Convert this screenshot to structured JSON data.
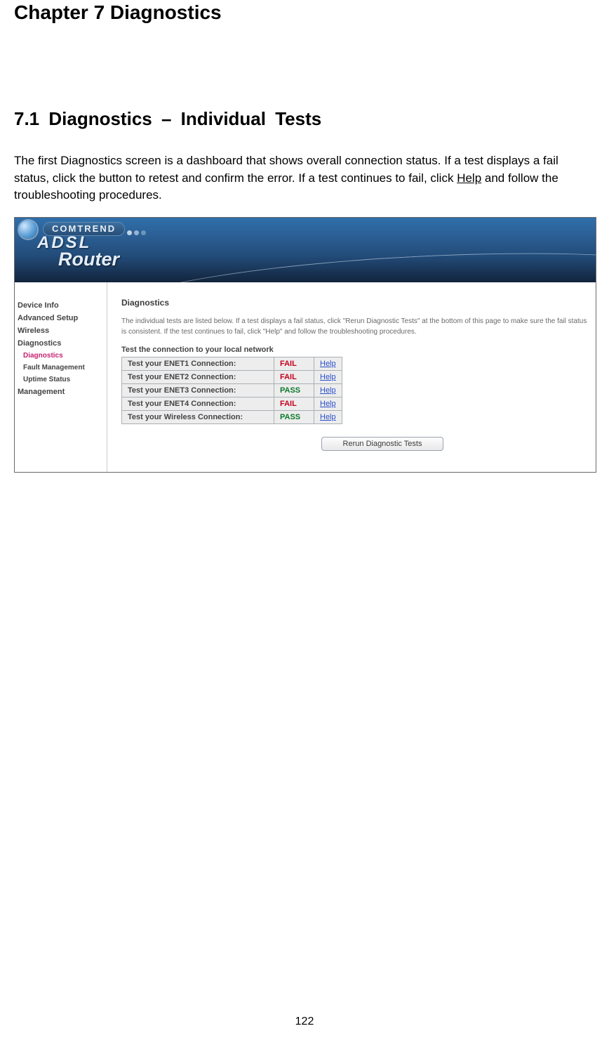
{
  "doc": {
    "chapter_title": "Chapter 7 Diagnostics",
    "section_title": "7.1 Diagnostics – Individual Tests",
    "body_text": "The first Diagnostics screen is a dashboard that shows overall connection status. If a test displays a fail status, click the button to retest and confirm the error. If a test continues to fail, click ",
    "body_help_word": "Help",
    "body_text_tail": " and follow the troubleshooting procedures.",
    "page_number": "122"
  },
  "router": {
    "brand": "COMTREND",
    "product_line1": "ADSL",
    "product_line2": "Router",
    "nav": {
      "items": [
        {
          "label": "Device Info",
          "active": false,
          "sub": false
        },
        {
          "label": "Advanced Setup",
          "active": false,
          "sub": false
        },
        {
          "label": "Wireless",
          "active": false,
          "sub": false
        },
        {
          "label": "Diagnostics",
          "active": false,
          "sub": false
        },
        {
          "label": "Diagnostics",
          "active": true,
          "sub": true
        },
        {
          "label": "Fault Management",
          "active": false,
          "sub": true
        },
        {
          "label": "Uptime Status",
          "active": false,
          "sub": true
        },
        {
          "label": "Management",
          "active": false,
          "sub": false
        }
      ]
    },
    "content": {
      "heading": "Diagnostics",
      "description": "The individual tests are listed below. If a test displays a fail status, click \"Rerun Diagnostic Tests\" at the bottom of this page to make sure the fail status is consistent. If the test continues to fail, click \"Help\" and follow the troubleshooting procedures.",
      "section_label": "Test the connection to your local network",
      "help_label": "Help",
      "tests": [
        {
          "label": "Test your ENET1 Connection:",
          "result": "FAIL",
          "pass": false
        },
        {
          "label": "Test your ENET2 Connection:",
          "result": "FAIL",
          "pass": false
        },
        {
          "label": "Test your ENET3 Connection:",
          "result": "PASS",
          "pass": true
        },
        {
          "label": "Test your ENET4 Connection:",
          "result": "FAIL",
          "pass": false
        },
        {
          "label": "Test your Wireless Connection:",
          "result": "PASS",
          "pass": true
        }
      ],
      "rerun_label": "Rerun Diagnostic Tests"
    }
  }
}
